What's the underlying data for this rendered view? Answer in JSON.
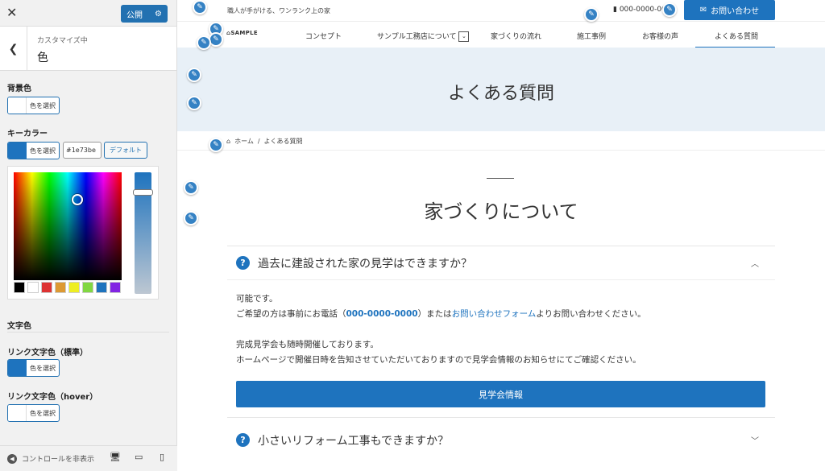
{
  "panel": {
    "publish_label": "公開",
    "crumb_sub": "カスタマイズ中",
    "crumb_title": "色",
    "bg_label": "背景色",
    "select_color": "色を選択",
    "key_label": "キーカラー",
    "key_hex": "#1e73be",
    "default_label": "デフォルト",
    "text_color_label": "文字色",
    "link_label": "リンク文字色（標準）",
    "link_hover_label": "リンク文字色（hover）",
    "hide_controls": "コントロールを非表示",
    "colors": {
      "key": "#1e73be",
      "link": "#1e73be",
      "bg": "#ffffff",
      "hover": "#ffffff",
      "palette": [
        "#000000",
        "#ffffff",
        "#dd3333",
        "#dd9933",
        "#eeee22",
        "#81d742",
        "#1e73be",
        "#8224e3"
      ]
    }
  },
  "site": {
    "tagline": "職人が手がける、ワンランク上の家",
    "phone": "000-0000-0000",
    "contact_label": "お問い合わせ",
    "logo": "SAMPLE",
    "nav": [
      "コンセプト",
      "サンプル工務店について",
      "家づくりの流れ",
      "施工事例",
      "お客様の声",
      "よくある質問"
    ],
    "hero_title": "よくある質問",
    "breadcrumb_home": "ホーム",
    "breadcrumb_sep": "/",
    "breadcrumb_current": "よくある質問",
    "section_title": "家づくりについて",
    "faq": [
      {
        "q": "過去に建設された家の見学はできますか？",
        "a1": "可能です。",
        "a2_pre": "ご希望の方は事前にお電話（",
        "a2_phone": "000-0000-0000",
        "a2_mid": "）または",
        "a2_link": "お問い合わせフォーム",
        "a2_post": "よりお問い合わせください。",
        "a3": "完成見学会も随時開催しております。",
        "a4": "ホームページで開催日時を告知させていただいておりますので見学会情報のお知らせにてご確認ください。",
        "button": "見学会情報"
      },
      {
        "q": "小さいリフォーム工事もできますか？"
      }
    ]
  }
}
